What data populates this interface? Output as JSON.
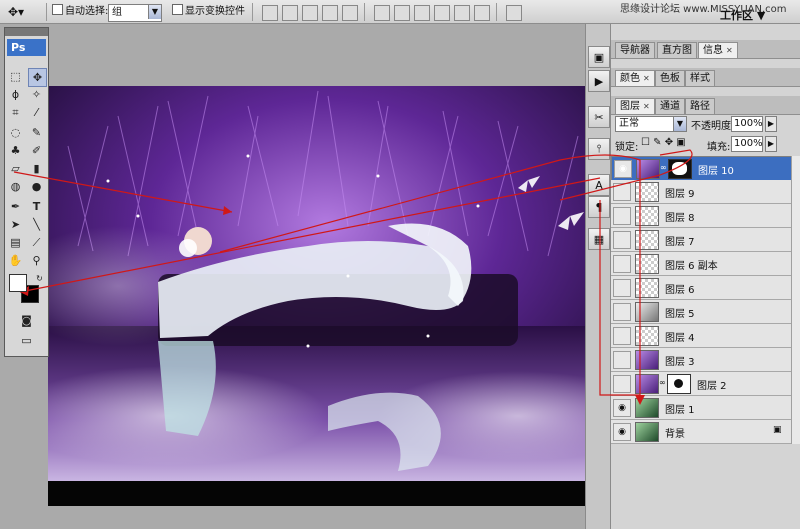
{
  "optionsbar": {
    "auto_select_label": "自动选择:",
    "auto_select_value": "组",
    "show_transform_label": "显示变换控件",
    "workspace_label": "工作区",
    "watermark": "思缘设计论坛 www.MISSYUAN.com"
  },
  "toolbox": {
    "logo": "Ps"
  },
  "panels": {
    "top_tabs": [
      "导航器",
      "直方图",
      "信息"
    ],
    "color_tabs": [
      "颜色",
      "色板",
      "样式"
    ],
    "layer_tabs": [
      "图层",
      "通道",
      "路径"
    ],
    "blend_mode": "正常",
    "opacity_label": "不透明度:",
    "opacity_value": "100%",
    "lock_label": "锁定:",
    "fill_label": "填充:",
    "fill_value": "100%"
  },
  "layers": [
    {
      "name": "图层 10",
      "visible": true,
      "selected": true,
      "thumb": "purple",
      "mask": true,
      "mask_style": "white-shape"
    },
    {
      "name": "图层 9",
      "visible": false,
      "selected": false,
      "thumb": "checker"
    },
    {
      "name": "图层 8",
      "visible": false,
      "selected": false,
      "thumb": "checker"
    },
    {
      "name": "图层 7",
      "visible": false,
      "selected": false,
      "thumb": "checker"
    },
    {
      "name": "图层 6 副本",
      "visible": false,
      "selected": false,
      "thumb": "checker"
    },
    {
      "name": "图层 6",
      "visible": false,
      "selected": false,
      "thumb": "checker"
    },
    {
      "name": "图层 5",
      "visible": false,
      "selected": false,
      "thumb": "gray"
    },
    {
      "name": "图层 4",
      "visible": false,
      "selected": false,
      "thumb": "checker"
    },
    {
      "name": "图层 3",
      "visible": false,
      "selected": false,
      "thumb": "purple"
    },
    {
      "name": "图层 2",
      "visible": false,
      "selected": false,
      "thumb": "purple",
      "mask": true,
      "mask_style": "black-shape"
    },
    {
      "name": "图层 1",
      "visible": true,
      "selected": false,
      "thumb": "green"
    },
    {
      "name": "背景",
      "visible": true,
      "selected": false,
      "thumb": "green",
      "locked": true
    }
  ],
  "colors": {
    "accent": "#3c6ec0",
    "arrow_red": "#d01818",
    "canvas_purple": "#6a2ca8"
  }
}
